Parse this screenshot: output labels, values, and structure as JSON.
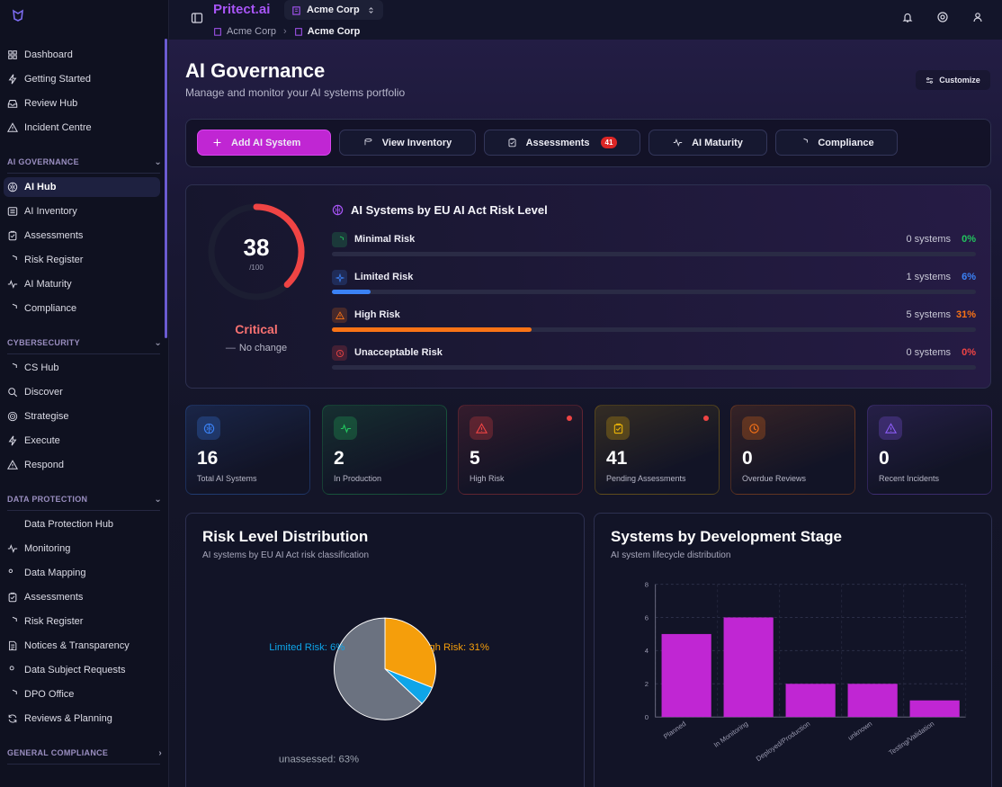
{
  "app": {
    "name": "Pritect.ai",
    "org": "Acme Corp"
  },
  "breadcrumb": {
    "org": "Acme Corp",
    "current": "Acme Corp"
  },
  "sidebar": {
    "top_items": [
      {
        "label": "Dashboard",
        "icon": "grid-icon"
      },
      {
        "label": "Getting Started",
        "icon": "zap-icon"
      },
      {
        "label": "Review Hub",
        "icon": "inbox-icon"
      },
      {
        "label": "Incident Centre",
        "icon": "alert-icon"
      }
    ],
    "sections": [
      {
        "title": "AI GOVERNANCE",
        "items": [
          {
            "label": "AI Hub",
            "icon": "brain-icon",
            "active": true
          },
          {
            "label": "AI Inventory",
            "icon": "list-icon"
          },
          {
            "label": "Assessments",
            "icon": "clipboard-icon"
          },
          {
            "label": "Risk Register",
            "icon": "shield-alert-icon"
          },
          {
            "label": "AI Maturity",
            "icon": "activity-icon"
          },
          {
            "label": "Compliance",
            "icon": "shield-icon"
          }
        ]
      },
      {
        "title": "CYBERSECURITY",
        "items": [
          {
            "label": "CS Hub",
            "icon": "shield-icon"
          },
          {
            "label": "Discover",
            "icon": "search-icon"
          },
          {
            "label": "Strategise",
            "icon": "target-icon"
          },
          {
            "label": "Execute",
            "icon": "zap-icon"
          },
          {
            "label": "Respond",
            "icon": "alert-icon"
          }
        ]
      },
      {
        "title": "DATA PROTECTION",
        "items": [
          {
            "label": "Data Protection Hub",
            "icon": "fingerprint-icon"
          },
          {
            "label": "Monitoring",
            "icon": "activity-icon"
          },
          {
            "label": "Data Mapping",
            "icon": "map-icon"
          },
          {
            "label": "Assessments",
            "icon": "clipboard-icon"
          },
          {
            "label": "Risk Register",
            "icon": "shield-alert-icon"
          },
          {
            "label": "Notices & Transparency",
            "icon": "file-icon"
          },
          {
            "label": "Data Subject Requests",
            "icon": "user-icon"
          },
          {
            "label": "DPO Office",
            "icon": "shield-icon"
          },
          {
            "label": "Reviews & Planning",
            "icon": "refresh-icon"
          }
        ]
      },
      {
        "title": "GENERAL COMPLIANCE",
        "items": []
      }
    ]
  },
  "page": {
    "title": "AI Governance",
    "subtitle": "Manage and monitor your AI systems portfolio",
    "customize_label": "Customize"
  },
  "actions": [
    {
      "label": "Add AI System",
      "icon": "plus-icon",
      "primary": true
    },
    {
      "label": "View Inventory",
      "icon": "database-icon"
    },
    {
      "label": "Assessments",
      "icon": "clipboard-icon",
      "badge": "41"
    },
    {
      "label": "AI Maturity",
      "icon": "activity-icon"
    },
    {
      "label": "Compliance",
      "icon": "shield-icon"
    }
  ],
  "score": {
    "value": "38",
    "max": "/100",
    "fraction": 0.38,
    "status": "Critical",
    "change": "No change"
  },
  "risk_panel": {
    "title": "AI Systems by EU AI Act Risk Level",
    "rows": [
      {
        "name": "Minimal Risk",
        "count": "0 systems",
        "pct": "0%",
        "fraction": 0,
        "color": "#22c55e",
        "icon": "shield-icon"
      },
      {
        "name": "Limited Risk",
        "count": "1 systems",
        "pct": "6%",
        "fraction": 0.06,
        "color": "#3b82f6",
        "icon": "sparkle-icon"
      },
      {
        "name": "High Risk",
        "count": "5 systems",
        "pct": "31%",
        "fraction": 0.31,
        "color": "#f97316",
        "icon": "warning-icon"
      },
      {
        "name": "Unacceptable Risk",
        "count": "0 systems",
        "pct": "0%",
        "fraction": 0,
        "color": "#ef4444",
        "icon": "ban-icon"
      }
    ]
  },
  "stats": [
    {
      "value": "16",
      "label": "Total AI Systems",
      "icon": "brain-icon",
      "color": "#3b82f6",
      "dot": false
    },
    {
      "value": "2",
      "label": "In Production",
      "icon": "activity-icon",
      "color": "#22c55e",
      "dot": false
    },
    {
      "value": "5",
      "label": "High Risk",
      "icon": "warning-icon",
      "color": "#ef4444",
      "dot": true
    },
    {
      "value": "41",
      "label": "Pending Assessments",
      "icon": "clipboard-icon",
      "color": "#eab308",
      "dot": true
    },
    {
      "value": "0",
      "label": "Overdue Reviews",
      "icon": "clock-icon",
      "color": "#f97316",
      "dot": false
    },
    {
      "value": "0",
      "label": "Recent Incidents",
      "icon": "alert-icon",
      "color": "#8b5cf6",
      "dot": false
    }
  ],
  "pie_card": {
    "title": "Risk Level Distribution",
    "subtitle": "AI systems by EU AI Act risk classification"
  },
  "bar_card": {
    "title": "Systems by Development Stage",
    "subtitle": "AI system lifecycle distribution"
  },
  "chart_data": [
    {
      "type": "pie",
      "categories": [
        "High Risk",
        "Limited Risk",
        "unassessed"
      ],
      "values": [
        31,
        6,
        63
      ],
      "slice_labels": [
        "High Risk: 31%",
        "Limited Risk: 6%",
        "unassessed: 63%"
      ],
      "colors": [
        "#f59e0b",
        "#0ea5e9",
        "#6b7280"
      ],
      "legend": [
        "High Risk",
        "Limited Risk",
        "unassessed"
      ],
      "legend_placement": "bottom"
    },
    {
      "type": "bar",
      "categories": [
        "Planned",
        "In Monitoring",
        "Deployed/Production",
        "unknown",
        "Testing/Validation"
      ],
      "values": [
        5,
        6,
        2,
        2,
        1
      ],
      "yticks": [
        "0",
        "2",
        "4",
        "6",
        "8"
      ],
      "ylim": [
        0,
        8
      ],
      "color": "#c026d3",
      "grid": true
    }
  ]
}
